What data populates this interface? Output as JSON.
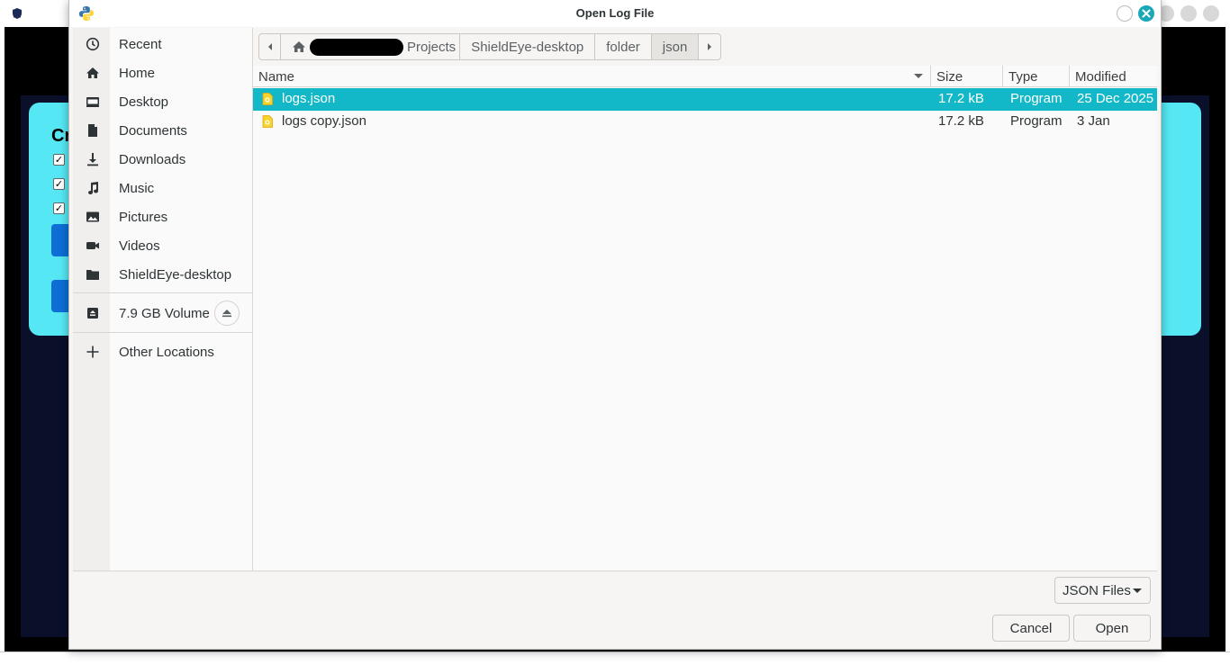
{
  "dialog": {
    "title": "Open Log File"
  },
  "sidebar": {
    "items": [
      {
        "label": "Recent",
        "icon": "clock-icon"
      },
      {
        "label": "Home",
        "icon": "home-icon"
      },
      {
        "label": "Desktop",
        "icon": "desktop-icon"
      },
      {
        "label": "Documents",
        "icon": "document-icon"
      },
      {
        "label": "Downloads",
        "icon": "download-icon"
      },
      {
        "label": "Music",
        "icon": "music-icon"
      },
      {
        "label": "Pictures",
        "icon": "picture-icon"
      },
      {
        "label": "Videos",
        "icon": "video-camera-icon"
      },
      {
        "label": "ShieldEye-desktop",
        "icon": "folder-icon"
      }
    ],
    "volume": {
      "label": "7.9 GB Volume",
      "icon": "drive-icon"
    },
    "other": {
      "label": "Other Locations",
      "icon": "plus-icon"
    }
  },
  "pathbar": {
    "segments": [
      "Projects",
      "ShieldEye-desktop",
      "folder",
      "json"
    ],
    "active": "json"
  },
  "filelist": {
    "columns": {
      "name": "Name",
      "size": "Size",
      "type": "Type",
      "modified": "Modified"
    },
    "rows": [
      {
        "name": "logs.json",
        "size": "17.2 kB",
        "type": "Program",
        "modified": "25 Dec 2025",
        "selected": true
      },
      {
        "name": "logs copy.json",
        "size": "17.2 kB",
        "type": "Program",
        "modified": "3 Jan",
        "selected": false
      }
    ]
  },
  "footer": {
    "filter": "JSON Files",
    "cancel": "Cancel",
    "open": "Open"
  },
  "background": {
    "card_title": "Cr"
  },
  "colors": {
    "selection": "#12b8c8",
    "accent_close": "#1aa8b8",
    "bg_card": "#55e8f4",
    "bg_dark": "#0a0f2a"
  }
}
